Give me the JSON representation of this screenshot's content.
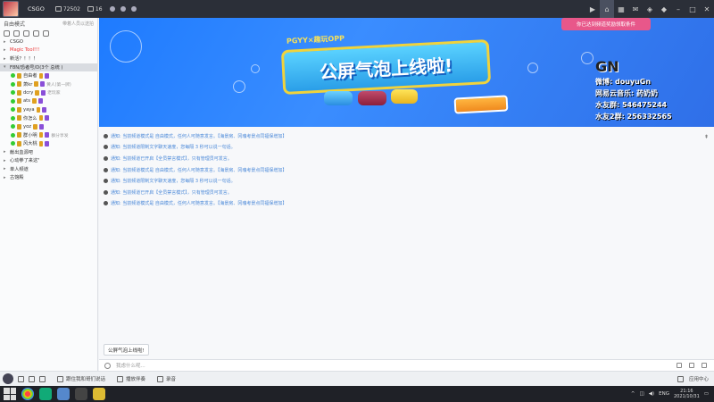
{
  "titlebar": {
    "room_name": "CSGO",
    "room_id": "72502",
    "user_count": "16"
  },
  "sidebar": {
    "mode_label": "自由模式",
    "mode_hint": "带着人员以送拍",
    "channels": [
      {
        "label": "CSGO",
        "red": false,
        "arrow": "▸",
        "selected": false
      },
      {
        "label": "Magic Tool!!!",
        "red": true,
        "arrow": "▸",
        "selected": false
      },
      {
        "label": "新活？！！！",
        "red": false,
        "arrow": "▸",
        "selected": false
      },
      {
        "label": "F8N/恐者号/D(3个 总统 )",
        "red": false,
        "arrow": "▾",
        "selected": true
      }
    ],
    "users": [
      {
        "name": "自由者",
        "tag": ""
      },
      {
        "name": "萧kr",
        "tag": "黄人(第一牌)"
      },
      {
        "name": "dcry",
        "tag": "老玩家"
      },
      {
        "name": "ats",
        "tag": ""
      },
      {
        "name": "yaya",
        "tag": ""
      },
      {
        "name": "你怎么",
        "tag": ""
      },
      {
        "name": "yoz",
        "tag": ""
      },
      {
        "name": "群小明",
        "tag": "群分享发"
      },
      {
        "name": "风大桃",
        "tag": ""
      }
    ],
    "channels_bottom": [
      {
        "label": "献出血源吧",
        "arrow": "▸"
      },
      {
        "label": "心动拳了来这\"",
        "arrow": "▸"
      },
      {
        "label": "单人频道",
        "arrow": "▸"
      },
      {
        "label": "古馆殿",
        "arrow": "▸"
      }
    ]
  },
  "banner": {
    "title": "公屏气泡上线啦!",
    "subtitle": "PGYY×趣玩OPP",
    "notify": "你已达到频道奖励领取条件",
    "gn": "GN",
    "streamer_lines": [
      "微博: douyuGn",
      "网易云音乐: 药奶奶",
      "水友群: 546475244",
      "水友2群: 256332565"
    ]
  },
  "chat": {
    "messages": [
      "通知: 当前频道模式是 自由模式，任何人可随意发言。【海景房、冈魂考景点同福保增加】",
      "通知: 当前频道限制文字聊天速度，您每隔 3 秒可以说一句话。",
      "通知: 当前频道已开启【全员禁言模式】，只有管理员可发言。",
      "通知: 当前频道模式是 自由模式，任何人可随意发言。【海景房、冈魂考景点同福保增加】",
      "通知: 当前频道限制文字聊天速度，您每隔 3 秒可以说一句话。",
      "通知: 当前频道已开启【全员禁言模式】，只有管理员可发言。",
      "通知: 当前频道模式是 自由模式，任何人可随意发言。【海景房、冈魂考景点同福保增加】"
    ],
    "chip": "公屏气泡上线啦!",
    "input_placeholder": "我虑什么呢..."
  },
  "statusbar": {
    "item1": "跟住我和哥们说话",
    "item2": "播放伴奏",
    "item3": "录音",
    "right_label": "应用中心"
  },
  "taskbar": {
    "lang": "ENG",
    "time": "21:16",
    "date": "2021/10/31"
  },
  "colors": {
    "banner_blue": "#1e7bff",
    "sign_gold": "#f0d33c",
    "notify_pink": "#e8578a"
  }
}
